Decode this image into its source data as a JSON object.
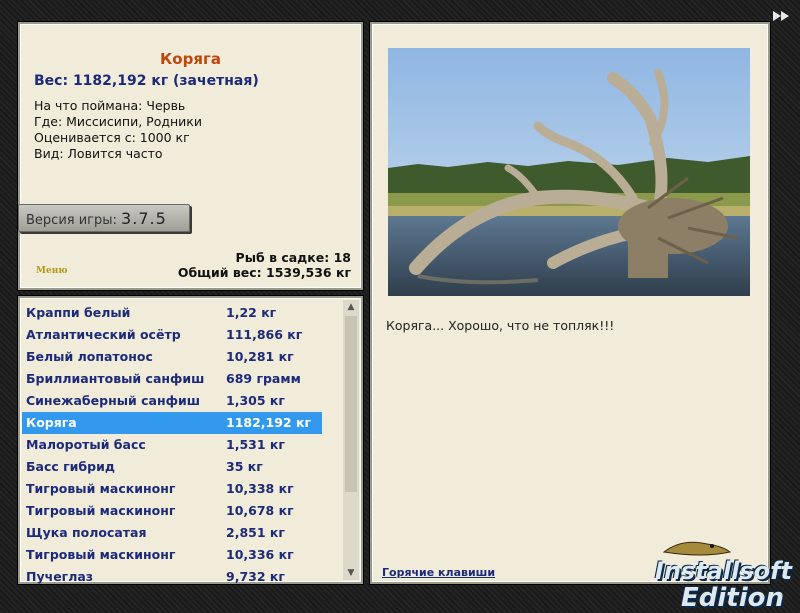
{
  "catch": {
    "name": "Коряга",
    "weight_line": "Вес: 1182,192 кг (зачетная)",
    "bait": "На что поймана: Червь",
    "place": "Где: Миссисипи, Родники",
    "valued": "Оценивается с: 1000 кг",
    "kind": "Вид: Ловится часто"
  },
  "version": {
    "label": "Версия игры:",
    "value": "3.7.5"
  },
  "menu_label": "Меню",
  "stats": {
    "count": "Рыб в садке: 18",
    "total": "Общий вес: 1539,536 кг"
  },
  "fish_list": [
    {
      "name": "Краппи белый",
      "weight": "1,22 кг"
    },
    {
      "name": "Атлантический осётр",
      "weight": "111,866 кг"
    },
    {
      "name": "Белый лопатонос",
      "weight": "10,281 кг"
    },
    {
      "name": "Бриллиантовый санфиш",
      "weight": "689 грамм"
    },
    {
      "name": "Синежаберный санфиш",
      "weight": "1,305 кг"
    },
    {
      "name": "Коряга",
      "weight": "1182,192 кг",
      "selected": true
    },
    {
      "name": "Малоротый басс",
      "weight": "1,531 кг"
    },
    {
      "name": "Басс гибрид",
      "weight": "35 кг"
    },
    {
      "name": "Тигровый маскинонг",
      "weight": "10,338 кг"
    },
    {
      "name": "Тигровый маскинонг",
      "weight": "10,678 кг"
    },
    {
      "name": "Щука полосатая",
      "weight": "2,851 кг"
    },
    {
      "name": "Тигровый маскинонг",
      "weight": "10,336 кг"
    },
    {
      "name": "Пучеглаз",
      "weight": "9,732 кг"
    }
  ],
  "caption": "Коряга... Хорошо, что не топляк!!!",
  "hotkeys": "Горячие клавиши",
  "brand": {
    "line1": "Installsoft",
    "line2": "Edition"
  },
  "colors": {
    "accent": "#c0460c",
    "link": "#1c2a7a",
    "selection": "#3399ee"
  },
  "icons": {
    "forward": "fast-forward-icon",
    "scroll_up": "scroll-up-arrow-icon",
    "scroll_down": "scroll-down-arrow-icon"
  }
}
